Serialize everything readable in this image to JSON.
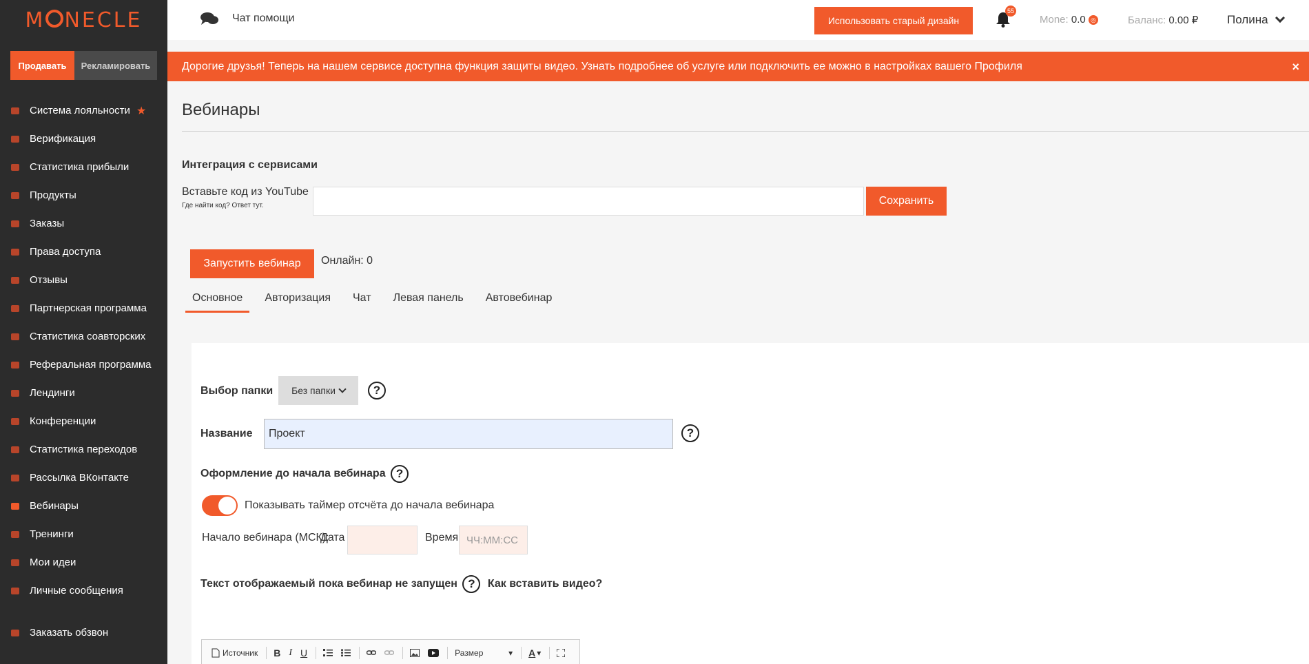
{
  "brand": {
    "logo_left": "M",
    "logo_right": "NECLE"
  },
  "sidebar": {
    "sell_label": "Продавать",
    "ads_label": "Рекламировать",
    "items": [
      {
        "name": "sidebar-item-loyalty",
        "label": "Система лояльности"
      },
      {
        "name": "sidebar-item-verification",
        "label": "Верификация"
      },
      {
        "name": "sidebar-item-profit-stats",
        "label": "Статистика прибыли"
      },
      {
        "name": "sidebar-item-products",
        "label": "Продукты"
      },
      {
        "name": "sidebar-item-orders",
        "label": "Заказы"
      },
      {
        "name": "sidebar-item-access",
        "label": "Права доступа"
      },
      {
        "name": "sidebar-item-reviews",
        "label": "Отзывы"
      },
      {
        "name": "sidebar-item-partner",
        "label": "Партнерская программа"
      },
      {
        "name": "sidebar-item-coauthor-stats",
        "label": "Статистика соавторских"
      },
      {
        "name": "sidebar-item-referral",
        "label": "Реферальная программа"
      },
      {
        "name": "sidebar-item-landings",
        "label": "Лендинги"
      },
      {
        "name": "sidebar-item-conferences",
        "label": "Конференции"
      },
      {
        "name": "sidebar-item-click-stats",
        "label": "Статистика переходов"
      },
      {
        "name": "sidebar-item-vk-mailing",
        "label": "Рассылка ВКонтакте"
      },
      {
        "name": "sidebar-item-webinars",
        "label": "Вебинары"
      },
      {
        "name": "sidebar-item-trainings",
        "label": "Тренинги"
      },
      {
        "name": "sidebar-item-ideas",
        "label": "Мои идеи"
      },
      {
        "name": "sidebar-item-messages",
        "label": "Личные сообщения"
      }
    ],
    "call_label": "Заказать обзвон"
  },
  "topbar": {
    "chat_help": "Чат помощи",
    "old_design": "Использовать старый дизайн",
    "notif_count": "55",
    "mone_label": "Mone:",
    "mone_value": "0.0",
    "balance_label": "Баланс:",
    "balance_value": "0.00 ₽",
    "user_name": "Полина"
  },
  "banner": {
    "text": "Дорогие друзья! Теперь на нашем сервисе доступна функция защиты видео. Узнать подробнее об услуге или подключить ее можно в настройках вашего Профиля",
    "close": "×"
  },
  "page": {
    "title": "Вебинары",
    "integration_title": "Интеграция с сервисами",
    "youtube_label": "Вставьте код из YouTube",
    "youtube_hint": "Где найти код? Ответ тут.",
    "youtube_value": "",
    "save_label": "Сохранить",
    "start_label": "Запустить вебинар",
    "online_label": "Онлайн: 0",
    "tabs": [
      "Основное",
      "Авторизация",
      "Чат",
      "Левая панель",
      "Автовебинар"
    ]
  },
  "form": {
    "folder_label": "Выбор папки",
    "folder_value": "Без папки",
    "name_label": "Название",
    "name_value": "Проект",
    "design_label": "Оформление до начала вебинара",
    "timer_label": "Показывать таймер отсчёта до начала вебинара",
    "start_label": "Начало вебинара (МСК):",
    "date_label": "Дата",
    "time_label": "Время",
    "time_placeholder": "ЧЧ:ММ:СС",
    "text_label": "Текст отображаемый пока вебинар не запущен",
    "how_video": "Как вставить видео?",
    "help_glyph": "?"
  },
  "editor": {
    "source": "Источник",
    "bold": "B",
    "italic": "I",
    "underline": "U",
    "size": "Размер",
    "color": "A"
  },
  "colors": {
    "accent": "#f15a2b",
    "sidebar": "#2c2c2c"
  }
}
